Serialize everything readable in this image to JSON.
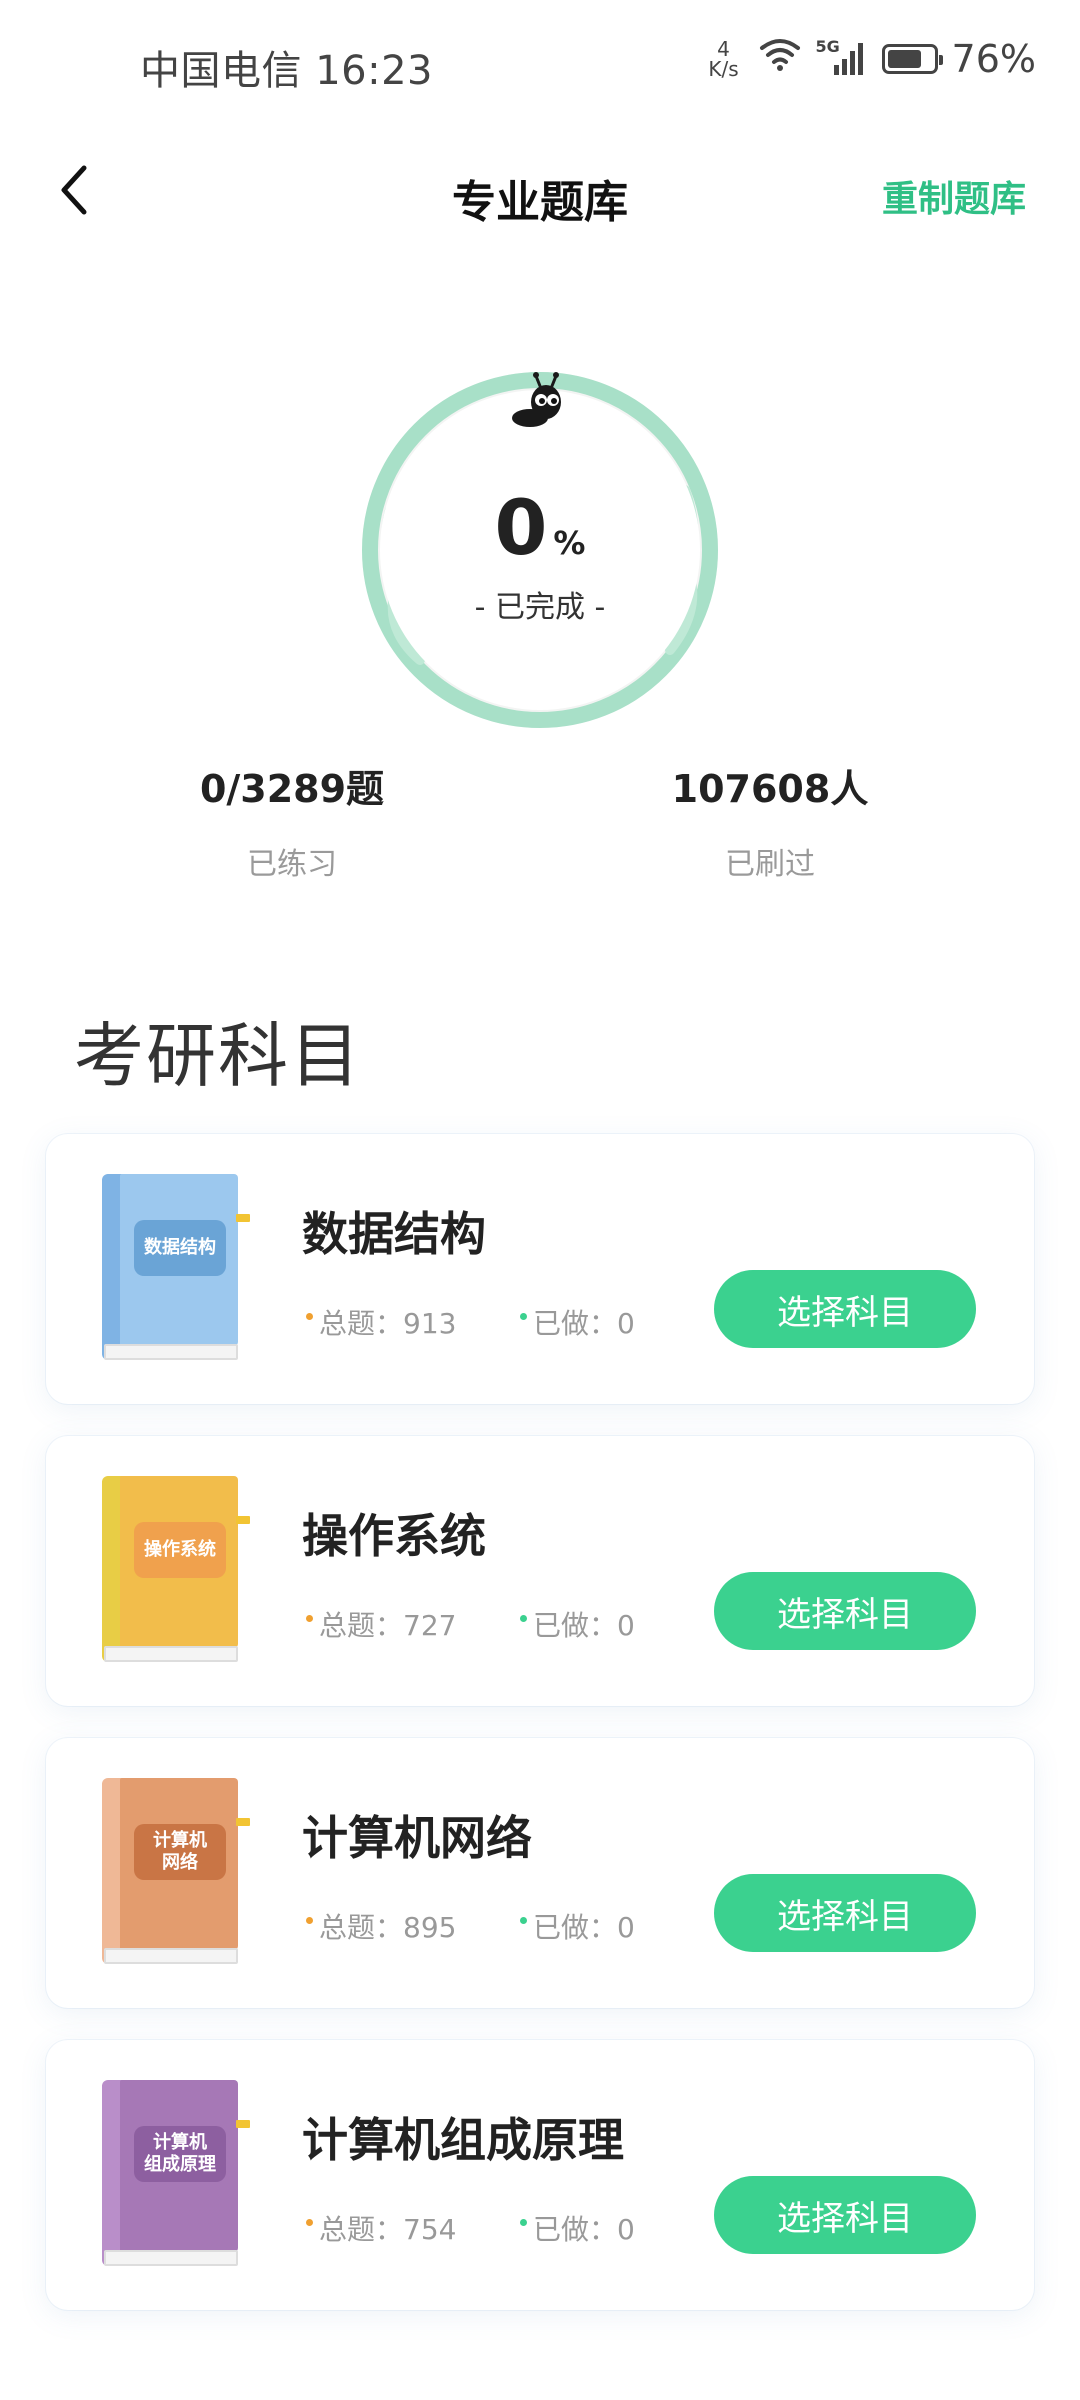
{
  "status_bar": {
    "carrier_time": "中国电信 16:23",
    "net_speed_value": "4",
    "net_speed_unit": "K/s",
    "network_type": "5G",
    "battery_percent": "76%",
    "battery_level": 0.76
  },
  "header": {
    "title": "专业题库",
    "action_label": "重制题库"
  },
  "progress": {
    "value": "0",
    "unit": "%",
    "caption": "- 已完成 -",
    "fraction": 0
  },
  "stats": {
    "practiced_value": "0/3289题",
    "practiced_label": "已练习",
    "users_value": "107608人",
    "users_label": "已刷过"
  },
  "section": {
    "title": "考研科目"
  },
  "subjects": [
    {
      "name": "数据结构",
      "cover_text": "数据结构",
      "total_label": "总题：913",
      "done_label": "已做：0",
      "button_label": "选择科目",
      "cover_color": "#9cc8ee",
      "spine_color": "#7fb3e4",
      "label_color": "#6aa4d6"
    },
    {
      "name": "操作系统",
      "cover_text": "操作系统",
      "total_label": "总题：727",
      "done_label": "已做：0",
      "button_label": "选择科目",
      "cover_color": "#f2bd4b",
      "spine_color": "#e8cd45",
      "label_color": "#f0a14d"
    },
    {
      "name": "计算机网络",
      "cover_text": "计算机\n网络",
      "total_label": "总题：895",
      "done_label": "已做：0",
      "button_label": "选择科目",
      "cover_color": "#e39c6e",
      "spine_color": "#efb896",
      "label_color": "#c97545"
    },
    {
      "name": "计算机组成原理",
      "cover_text": "计算机\n组成原理",
      "total_label": "总题：754",
      "done_label": "已做：0",
      "button_label": "选择科目",
      "cover_color": "#a678b6",
      "spine_color": "#b98ec9",
      "label_color": "#8d5fa0"
    }
  ],
  "colors": {
    "accent": "#2fbf85",
    "button": "#3bd18f",
    "ring": "#a8e0c8",
    "total_dot": "#f0a030",
    "done_dot": "#3bd18f"
  }
}
